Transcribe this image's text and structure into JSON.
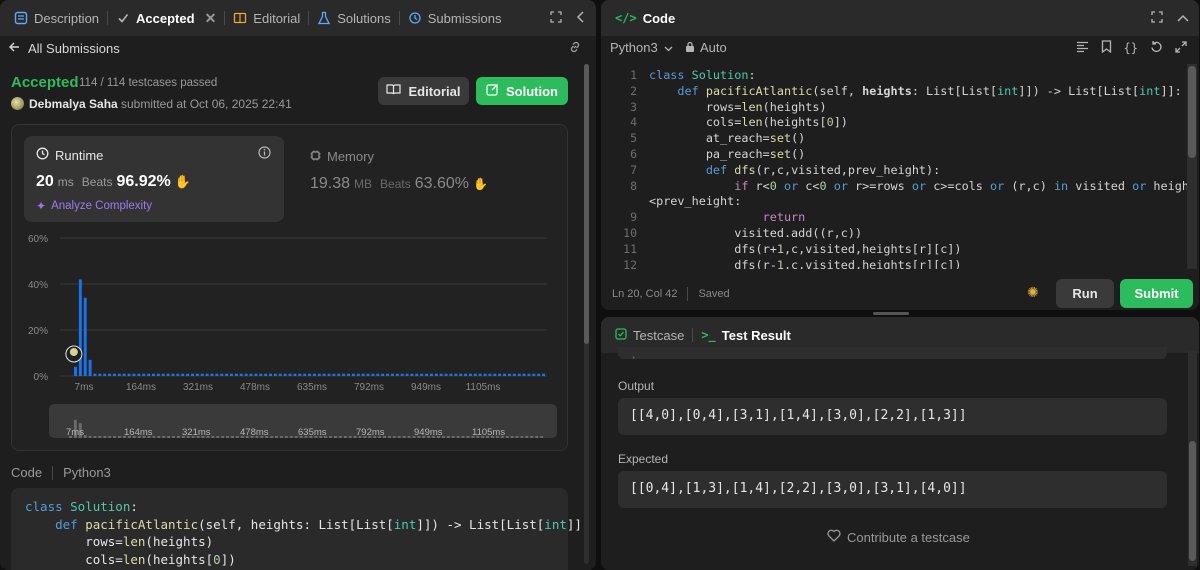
{
  "left_tabs": {
    "description": "Description",
    "accepted": "Accepted",
    "editorial": "Editorial",
    "solutions": "Solutions",
    "submissions": "Submissions"
  },
  "back_label": "All Submissions",
  "result": {
    "status": "Accepted",
    "testcases": "114 / 114 testcases passed",
    "user": "Debmalya Saha",
    "submitted_text": "submitted at Oct 06, 2025 22:41",
    "editorial_btn": "Editorial",
    "solution_btn": "Solution"
  },
  "runtime": {
    "label": "Runtime",
    "value": "20",
    "unit": "ms",
    "beats_label": "Beats",
    "beats_value": "96.92%",
    "analyze": "Analyze Complexity"
  },
  "memory": {
    "label": "Memory",
    "value": "19.38",
    "unit": "MB",
    "beats_label": "Beats",
    "beats_value": "63.60%"
  },
  "chart_data": {
    "type": "bar",
    "y_ticks": [
      "60%",
      "40%",
      "20%",
      "0%"
    ],
    "ylim": [
      0,
      60
    ],
    "x_ticks": [
      "7ms",
      "164ms",
      "321ms",
      "478ms",
      "635ms",
      "792ms",
      "949ms",
      "1105ms"
    ],
    "values": [
      4,
      42,
      34,
      7,
      1,
      1,
      1,
      1,
      1,
      1,
      1,
      1,
      1,
      1,
      1,
      1,
      1,
      1,
      1,
      1,
      1,
      1,
      1,
      1,
      1,
      1,
      1,
      1,
      1,
      1,
      1,
      1,
      1,
      1,
      1,
      1,
      1,
      1,
      1,
      1,
      1,
      1,
      1,
      1,
      1,
      1,
      1,
      1,
      1,
      1,
      1,
      1,
      1,
      1,
      1,
      1,
      1,
      1,
      1,
      1,
      1,
      1,
      1,
      1,
      1,
      1,
      1,
      1,
      1,
      1,
      1,
      1,
      1,
      1,
      1,
      1,
      1,
      1,
      1,
      1,
      1,
      1,
      1,
      1,
      1,
      1,
      1,
      1,
      1,
      1,
      1,
      1,
      1,
      1,
      1,
      1,
      1
    ],
    "highlight_index": 1,
    "bar_color": "#1a73e8",
    "grid": true
  },
  "code_section": {
    "label": "Code",
    "lang": "Python3",
    "lines": [
      [
        [
          "kw",
          "class "
        ],
        [
          "cls",
          "Solution"
        ],
        [
          "",
          ":"
        ]
      ],
      [
        [
          "",
          "    "
        ],
        [
          "kw",
          "def "
        ],
        [
          "fn",
          "pacificAtlantic"
        ],
        [
          "",
          "(self, heights: List[List["
        ],
        [
          "cls",
          "int"
        ],
        [
          "",
          "]]) -> List[List["
        ],
        [
          "cls",
          "int"
        ],
        [
          "",
          "]]:"
        ]
      ],
      [
        [
          "",
          "        rows="
        ],
        [
          "fn",
          "len"
        ],
        [
          "",
          "(heights)"
        ]
      ],
      [
        [
          "",
          "        cols="
        ],
        [
          "fn",
          "len"
        ],
        [
          "",
          "(heights["
        ],
        [
          "num",
          "0"
        ],
        [
          "",
          "])"
        ]
      ]
    ]
  },
  "code_panel": {
    "title": "Code",
    "lang": "Python3",
    "mode": "Auto",
    "status": "Ln 20, Col 42",
    "saved": "Saved",
    "run": "Run",
    "submit": "Submit",
    "line_numbers": [
      "1",
      "2",
      "3",
      "4",
      "5",
      "6",
      "7",
      "8",
      "",
      "9",
      "10",
      "11",
      "12"
    ],
    "lines": [
      [
        [
          "kw",
          "class "
        ],
        [
          "cls",
          "Solution"
        ],
        [
          "",
          ":"
        ]
      ],
      [
        [
          "",
          "    "
        ],
        [
          "kw",
          "def "
        ],
        [
          "fn",
          "pacificAtlantic"
        ],
        [
          "",
          "(self, "
        ],
        [
          "b",
          "heights"
        ],
        [
          "",
          ": List[List["
        ],
        [
          "cls",
          "int"
        ],
        [
          "",
          "]]) -> List[List["
        ],
        [
          "cls",
          "int"
        ],
        [
          "",
          "]]:"
        ]
      ],
      [
        [
          "",
          "        rows="
        ],
        [
          "fn",
          "len"
        ],
        [
          "",
          "(heights)"
        ]
      ],
      [
        [
          "",
          "        cols="
        ],
        [
          "fn",
          "len"
        ],
        [
          "",
          "(heights["
        ],
        [
          "num",
          "0"
        ],
        [
          "",
          "])"
        ]
      ],
      [
        [
          "",
          "        at_reach="
        ],
        [
          "fn",
          "set"
        ],
        [
          "",
          "()"
        ]
      ],
      [
        [
          "",
          "        pa_reach="
        ],
        [
          "fn",
          "set"
        ],
        [
          "",
          "()"
        ]
      ],
      [
        [
          "",
          "        "
        ],
        [
          "kw",
          "def "
        ],
        [
          "fn",
          "dfs"
        ],
        [
          "",
          "(r,c,visited,prev_height):"
        ]
      ],
      [
        [
          "",
          "            "
        ],
        [
          "ctl",
          "if "
        ],
        [
          "",
          "r<"
        ],
        [
          "num",
          "0"
        ],
        [
          "kw",
          " or "
        ],
        [
          "",
          "c<"
        ],
        [
          "num",
          "0"
        ],
        [
          "kw",
          " or "
        ],
        [
          "",
          "r>=rows"
        ],
        [
          "kw",
          " or "
        ],
        [
          "",
          "c>=cols"
        ],
        [
          "kw",
          " or "
        ],
        [
          "",
          "(r,c)"
        ],
        [
          "kw",
          " in "
        ],
        [
          "",
          "visited"
        ],
        [
          "kw",
          " or "
        ],
        [
          "",
          "heights[r][c]"
        ]
      ],
      [
        [
          "",
          "<prev_height:"
        ]
      ],
      [
        [
          "",
          "                "
        ],
        [
          "ctl",
          "return"
        ]
      ],
      [
        [
          "",
          "            visited.add((r,c))"
        ]
      ],
      [
        [
          "",
          "            dfs(r+"
        ],
        [
          "num",
          "1"
        ],
        [
          "",
          ",c,visited,heights[r][c])"
        ]
      ],
      [
        [
          "",
          "            dfs(r-"
        ],
        [
          "num",
          "1"
        ],
        [
          "",
          ",c,visited,heights[r][c])"
        ]
      ]
    ]
  },
  "test_panel": {
    "testcase_tab": "Testcase",
    "result_tab": "Test Result",
    "output_label": "Output",
    "output_value": "[[4,0],[0,4],[3,1],[1,4],[3,0],[2,2],[1,3]]",
    "expected_label": "Expected",
    "expected_value": "[[0,4],[1,3],[1,4],[2,2],[3,0],[3,1],[4,0]]",
    "contribute": "Contribute a testcase"
  },
  "colors": {
    "accent_green": "#2cbb5d",
    "accepted_green": "#2cbb5d",
    "bar_blue": "#1a73e8"
  }
}
